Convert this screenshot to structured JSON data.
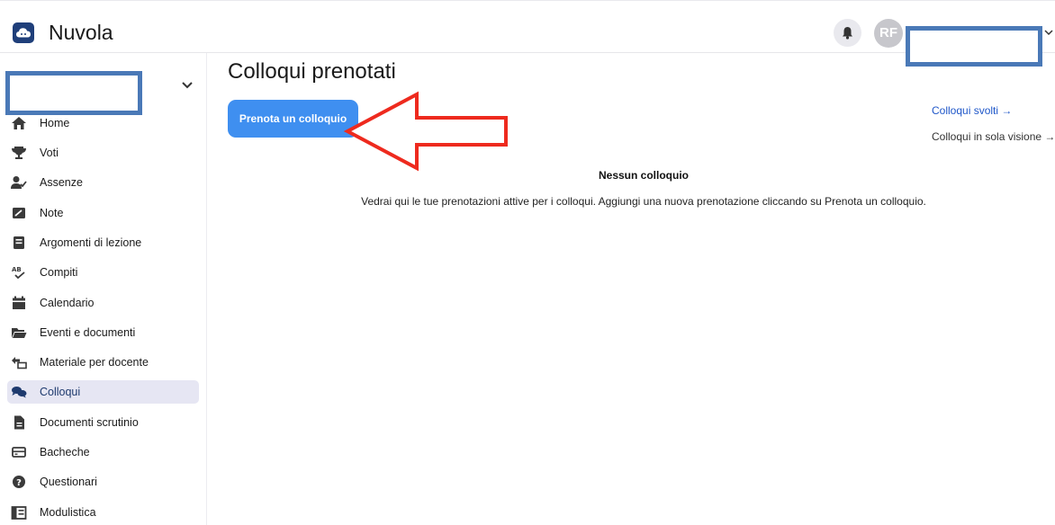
{
  "app": {
    "title": "Nuvola",
    "avatar_initials": "RF"
  },
  "sidebar": {
    "items": [
      {
        "label": "Home",
        "icon": "house-icon"
      },
      {
        "label": "Voti",
        "icon": "trophy-icon"
      },
      {
        "label": "Assenze",
        "icon": "user-check-icon"
      },
      {
        "label": "Note",
        "icon": "note-icon"
      },
      {
        "label": "Argomenti di lezione",
        "icon": "book-icon"
      },
      {
        "label": "Compiti",
        "icon": "spellcheck-icon"
      },
      {
        "label": "Calendario",
        "icon": "calendar-icon"
      },
      {
        "label": "Eventi e documenti",
        "icon": "folder-open-icon"
      },
      {
        "label": "Materiale per docente",
        "icon": "exchange-icon"
      },
      {
        "label": "Colloqui",
        "icon": "chat-bubbles-icon",
        "active": true
      },
      {
        "label": "Documenti scrutinio",
        "icon": "document-icon"
      },
      {
        "label": "Bacheche",
        "icon": "board-icon"
      },
      {
        "label": "Questionari",
        "icon": "question-icon"
      },
      {
        "label": "Modulistica",
        "icon": "forms-icon"
      }
    ]
  },
  "main": {
    "title": "Colloqui prenotati",
    "primary_button": "Prenota un colloquio",
    "links": [
      {
        "label": "Colloqui svolti →"
      },
      {
        "label": "Colloqui in sola visione →"
      }
    ],
    "empty_state": {
      "title": "Nessun colloquio",
      "text": "Vedrai qui le tue prenotazioni attive per i colloqui. Aggiungi una nuova prenotazione cliccando su Prenota un colloquio."
    }
  },
  "colors": {
    "accent": "#3f8ff0",
    "link": "#1f57c9",
    "active_bg": "#e6e6f3",
    "annotation_red": "#ee2a1e",
    "redaction_blue": "#4a79b7",
    "logo_bg": "#1f3f7a"
  }
}
